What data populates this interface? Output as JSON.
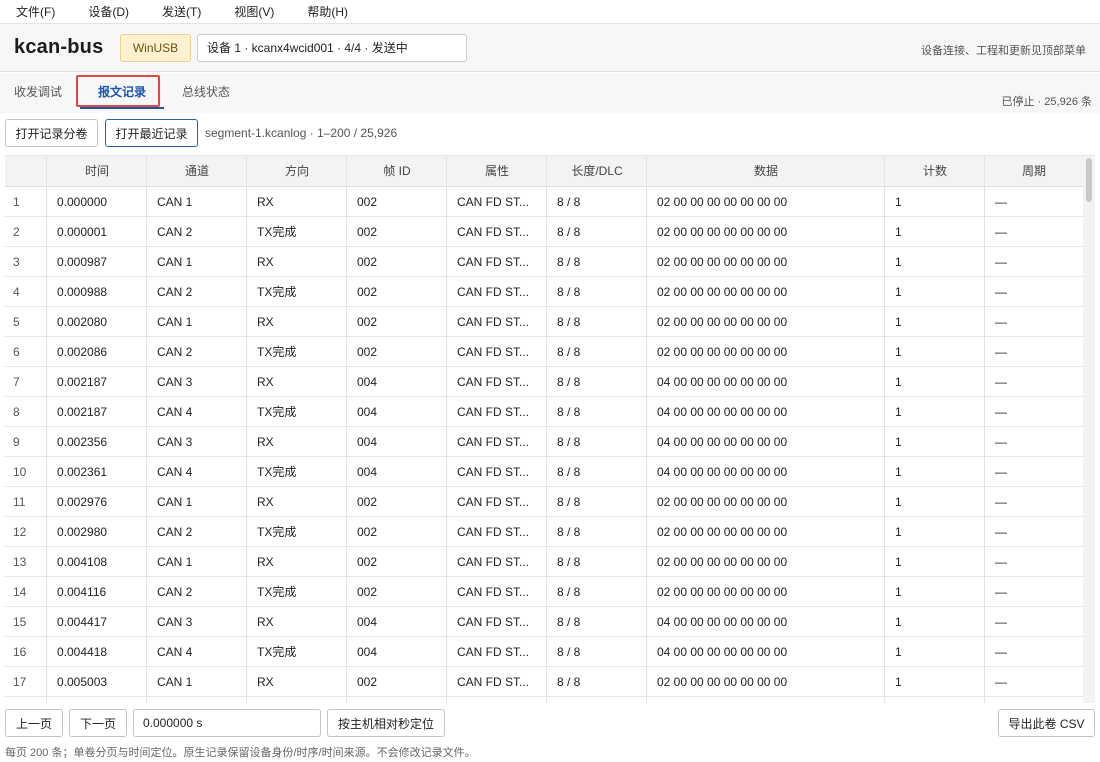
{
  "menu": [
    {
      "label": "文件(F)"
    },
    {
      "label": "设备(D)"
    },
    {
      "label": "发送(T)"
    },
    {
      "label": "视图(V)"
    },
    {
      "label": "帮助(H)"
    }
  ],
  "header": {
    "title": "kcan-bus",
    "driver_badge": "WinUSB",
    "device": "设备 1 · kcanx4wcid001 · 4/4 · 发送中",
    "hint": "设备连接、工程和更新见顶部菜单"
  },
  "tabs": [
    {
      "label": "收发调试",
      "active": false
    },
    {
      "label": "报文记录",
      "active": true
    },
    {
      "label": "总线状态",
      "active": false
    }
  ],
  "record_status": "已停止 · 25,926 条",
  "toolbar": {
    "open_segment": "打开记录分卷",
    "open_recent": "打开最近记录",
    "segment_info": "segment-1.kcanlog · 1–200 / 25,926"
  },
  "table": {
    "columns": [
      "时间",
      "通道",
      "方向",
      "帧 ID",
      "属性",
      "长度/DLC",
      "数据",
      "计数",
      "周期"
    ],
    "rows": [
      {
        "idx": "1",
        "time": "0.000000",
        "channel": "CAN 1",
        "dir": "RX",
        "id": "002",
        "attr": "CAN FD ST...",
        "len": "8 / 8",
        "data": "02 00 00 00 00 00 00 00",
        "count": "1",
        "period": "—"
      },
      {
        "idx": "2",
        "time": "0.000001",
        "channel": "CAN 2",
        "dir": "TX完成",
        "id": "002",
        "attr": "CAN FD ST...",
        "len": "8 / 8",
        "data": "02 00 00 00 00 00 00 00",
        "count": "1",
        "period": "—"
      },
      {
        "idx": "3",
        "time": "0.000987",
        "channel": "CAN 1",
        "dir": "RX",
        "id": "002",
        "attr": "CAN FD ST...",
        "len": "8 / 8",
        "data": "02 00 00 00 00 00 00 00",
        "count": "1",
        "period": "—"
      },
      {
        "idx": "4",
        "time": "0.000988",
        "channel": "CAN 2",
        "dir": "TX完成",
        "id": "002",
        "attr": "CAN FD ST...",
        "len": "8 / 8",
        "data": "02 00 00 00 00 00 00 00",
        "count": "1",
        "period": "—"
      },
      {
        "idx": "5",
        "time": "0.002080",
        "channel": "CAN 1",
        "dir": "RX",
        "id": "002",
        "attr": "CAN FD ST...",
        "len": "8 / 8",
        "data": "02 00 00 00 00 00 00 00",
        "count": "1",
        "period": "—"
      },
      {
        "idx": "6",
        "time": "0.002086",
        "channel": "CAN 2",
        "dir": "TX完成",
        "id": "002",
        "attr": "CAN FD ST...",
        "len": "8 / 8",
        "data": "02 00 00 00 00 00 00 00",
        "count": "1",
        "period": "—"
      },
      {
        "idx": "7",
        "time": "0.002187",
        "channel": "CAN 3",
        "dir": "RX",
        "id": "004",
        "attr": "CAN FD ST...",
        "len": "8 / 8",
        "data": "04 00 00 00 00 00 00 00",
        "count": "1",
        "period": "—"
      },
      {
        "idx": "8",
        "time": "0.002187",
        "channel": "CAN 4",
        "dir": "TX完成",
        "id": "004",
        "attr": "CAN FD ST...",
        "len": "8 / 8",
        "data": "04 00 00 00 00 00 00 00",
        "count": "1",
        "period": "—"
      },
      {
        "idx": "9",
        "time": "0.002356",
        "channel": "CAN 3",
        "dir": "RX",
        "id": "004",
        "attr": "CAN FD ST...",
        "len": "8 / 8",
        "data": "04 00 00 00 00 00 00 00",
        "count": "1",
        "period": "—"
      },
      {
        "idx": "10",
        "time": "0.002361",
        "channel": "CAN 4",
        "dir": "TX完成",
        "id": "004",
        "attr": "CAN FD ST...",
        "len": "8 / 8",
        "data": "04 00 00 00 00 00 00 00",
        "count": "1",
        "period": "—"
      },
      {
        "idx": "11",
        "time": "0.002976",
        "channel": "CAN 1",
        "dir": "RX",
        "id": "002",
        "attr": "CAN FD ST...",
        "len": "8 / 8",
        "data": "02 00 00 00 00 00 00 00",
        "count": "1",
        "period": "—"
      },
      {
        "idx": "12",
        "time": "0.002980",
        "channel": "CAN 2",
        "dir": "TX完成",
        "id": "002",
        "attr": "CAN FD ST...",
        "len": "8 / 8",
        "data": "02 00 00 00 00 00 00 00",
        "count": "1",
        "period": "—"
      },
      {
        "idx": "13",
        "time": "0.004108",
        "channel": "CAN 1",
        "dir": "RX",
        "id": "002",
        "attr": "CAN FD ST...",
        "len": "8 / 8",
        "data": "02 00 00 00 00 00 00 00",
        "count": "1",
        "period": "—"
      },
      {
        "idx": "14",
        "time": "0.004116",
        "channel": "CAN 2",
        "dir": "TX完成",
        "id": "002",
        "attr": "CAN FD ST...",
        "len": "8 / 8",
        "data": "02 00 00 00 00 00 00 00",
        "count": "1",
        "period": "—"
      },
      {
        "idx": "15",
        "time": "0.004417",
        "channel": "CAN 3",
        "dir": "RX",
        "id": "004",
        "attr": "CAN FD ST...",
        "len": "8 / 8",
        "data": "04 00 00 00 00 00 00 00",
        "count": "1",
        "period": "—"
      },
      {
        "idx": "16",
        "time": "0.004418",
        "channel": "CAN 4",
        "dir": "TX完成",
        "id": "004",
        "attr": "CAN FD ST...",
        "len": "8 / 8",
        "data": "04 00 00 00 00 00 00 00",
        "count": "1",
        "period": "—"
      },
      {
        "idx": "17",
        "time": "0.005003",
        "channel": "CAN 1",
        "dir": "RX",
        "id": "002",
        "attr": "CAN FD ST...",
        "len": "8 / 8",
        "data": "02 00 00 00 00 00 00 00",
        "count": "1",
        "period": "—"
      }
    ]
  },
  "footer": {
    "prev_page": "上一页",
    "next_page": "下一页",
    "time_value": "0.000000 s",
    "locate_button": "按主机相对秒定位",
    "export_button": "导出此卷 CSV",
    "note": "每页 200 条；单卷分页与时间定位。原生记录保留设备身份/时序/时间来源。不会修改记录文件。"
  },
  "colors": {
    "accent": "#1a56b0",
    "highlight": "#e04848",
    "badge_bg": "#fdf1cf"
  }
}
